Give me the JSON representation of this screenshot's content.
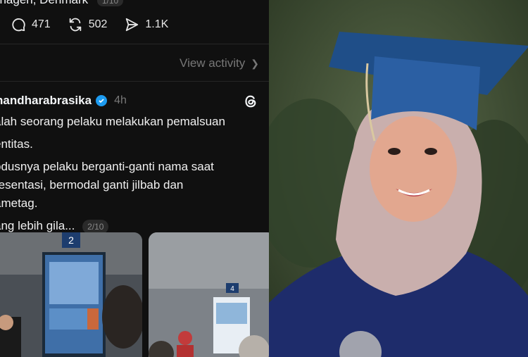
{
  "post_top": {
    "location": "nhagen, Denmark",
    "pager": "1/10"
  },
  "actions": {
    "replies": "471",
    "reposts": "502",
    "shares": "1.1K"
  },
  "view_activity": "View activity",
  "post": {
    "username": "nandharabrasika",
    "time": "4h",
    "lines": [
      "alah seorang pelaku melakukan pemalsuan",
      "entitas.",
      "odusnya pelaku berganti-ganti nama saat",
      "resentasi, bermodal ganti jilbab dan",
      "ametag.",
      "ang lebih gila..."
    ],
    "pager": "2/10"
  },
  "photo1": {
    "sign_number": "2"
  },
  "photo2": {
    "sign_number": "4"
  },
  "colors": {
    "threads_bg": "#101010",
    "verified": "#1d9bf0",
    "muted": "#777777"
  }
}
